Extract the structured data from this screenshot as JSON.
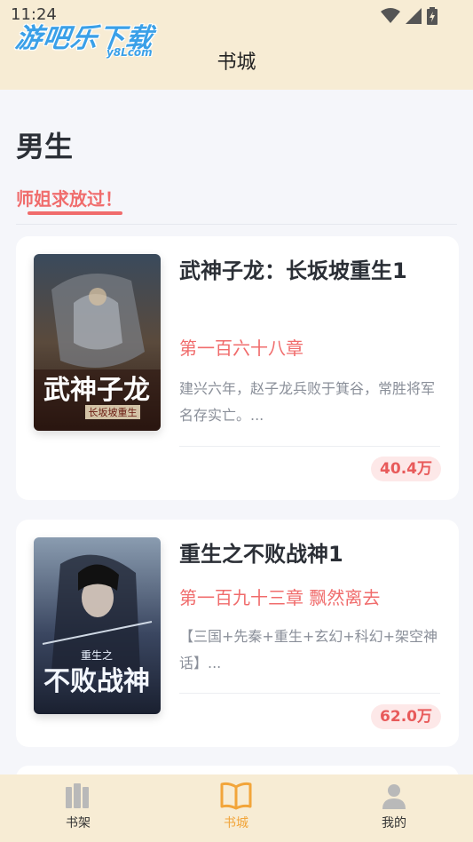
{
  "status_bar": {
    "time": "11:24"
  },
  "logo": {
    "main": "游吧乐下载",
    "sub": "y8Lcom"
  },
  "header": {
    "title": "书城"
  },
  "section": {
    "heading": "男生",
    "active_tab": "师姐求放过！"
  },
  "books": [
    {
      "title": "武神子龙：长坂坡重生1",
      "chapter": "第一百六十八章",
      "description": "建兴六年，赵子龙兵败于箕谷，常胜将军名存实亡。...",
      "count": "40.4万",
      "cover_text": "武神子龙",
      "cover_subtext": "长坂坡重生"
    },
    {
      "title": "重生之不败战神1",
      "chapter": "第一百九十三章 飘然离去",
      "description": "【三国+先秦+重生+玄幻+科幻+架空神话】...",
      "count": "62.0万",
      "cover_text": "不败战神",
      "cover_subtext": "重生之"
    }
  ],
  "bottom_nav": [
    {
      "label": "书架",
      "icon": "bookshelf-icon",
      "active": false
    },
    {
      "label": "书城",
      "icon": "open-book-icon",
      "active": true
    },
    {
      "label": "我的",
      "icon": "user-icon",
      "active": false
    }
  ],
  "colors": {
    "accent": "#f06c6c",
    "nav_active": "#f2a53a",
    "header_bg": "#f7ecd4"
  }
}
